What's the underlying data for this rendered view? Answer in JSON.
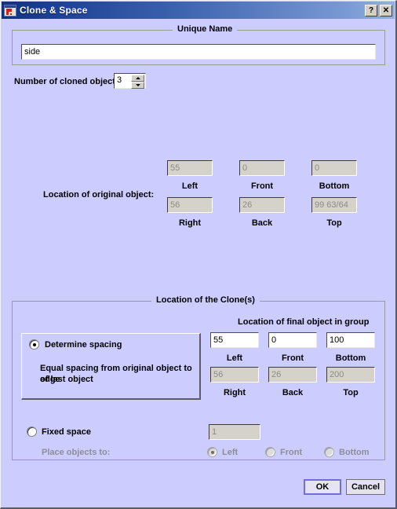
{
  "window": {
    "title": "Clone & Space",
    "icon": "app-icon",
    "help_button": "?",
    "close_button": "✕"
  },
  "unique_name": {
    "group_title": "Unique Name",
    "value": "side",
    "placeholder": ""
  },
  "clone_count": {
    "label": "Number of cloned objects",
    "value": "3",
    "spin_up": "▲",
    "spin_down": "▼"
  },
  "original_location": {
    "label": "Location of original object:",
    "fields": [
      {
        "name": "left",
        "label": "Left",
        "value": "55",
        "enabled": false
      },
      {
        "name": "front",
        "label": "Front",
        "value": "0",
        "enabled": false
      },
      {
        "name": "bottom",
        "label": "Bottom",
        "value": "0",
        "enabled": false
      },
      {
        "name": "right",
        "label": "Right",
        "value": "56",
        "enabled": false
      },
      {
        "name": "back",
        "label": "Back",
        "value": "26",
        "enabled": false
      },
      {
        "name": "top",
        "label": "Top",
        "value": "99 63/64",
        "enabled": false
      }
    ]
  },
  "clone_location": {
    "group_title": "Location of the Clone(s)",
    "final_object_heading": "Location of final object in group",
    "fields": [
      {
        "name": "left",
        "label": "Left",
        "value": "55",
        "enabled": true
      },
      {
        "name": "front",
        "label": "Front",
        "value": "0",
        "enabled": true
      },
      {
        "name": "bottom",
        "label": "Bottom",
        "value": "100",
        "enabled": true
      },
      {
        "name": "right",
        "label": "Right",
        "value": "56",
        "enabled": false
      },
      {
        "name": "back",
        "label": "Back",
        "value": "26",
        "enabled": false
      },
      {
        "name": "top",
        "label": "Top",
        "value": "200",
        "enabled": false
      }
    ],
    "determine_spacing": {
      "radio_label": "Determine spacing",
      "selected": true,
      "description_line1": "Equal spacing from original object to edge",
      "description_line2": "of last object"
    },
    "fixed_space": {
      "radio_label": "Fixed space",
      "selected": false,
      "value": "1",
      "enabled": false,
      "place_label": "Place objects to:",
      "options": [
        {
          "name": "left",
          "label": "Left",
          "selected": true,
          "enabled": false
        },
        {
          "name": "front",
          "label": "Front",
          "selected": false,
          "enabled": false
        },
        {
          "name": "bottom",
          "label": "Bottom",
          "selected": false,
          "enabled": false
        }
      ]
    }
  },
  "footer": {
    "ok_label": "OK",
    "cancel_label": "Cancel"
  },
  "colors": {
    "dialog_background": "#ccccff",
    "titlebar_start": "#12327d",
    "titlebar_end": "#96b0e0",
    "disabled_field": "#d5d2c9",
    "disabled_text": "#8e8e96",
    "default_button_border": "#6f6fdc"
  }
}
